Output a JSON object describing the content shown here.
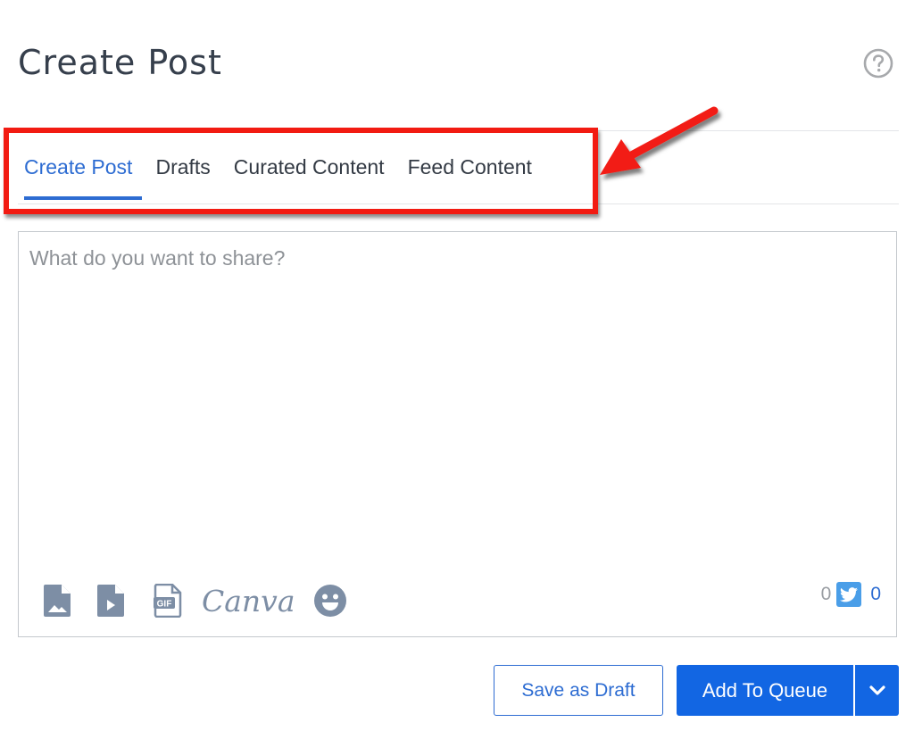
{
  "header": {
    "title": "Create Post",
    "help_icon": "question-circle-icon"
  },
  "tabs": [
    {
      "label": "Create Post",
      "active": true
    },
    {
      "label": "Drafts",
      "active": false
    },
    {
      "label": "Curated Content",
      "active": false
    },
    {
      "label": "Feed Content",
      "active": false
    }
  ],
  "annotation": {
    "highlight_color": "#f21b12",
    "type": "red box with arrow pointing at tabs"
  },
  "composer": {
    "value": "",
    "placeholder": "What do you want to share?",
    "attachments": [
      {
        "name": "image-file-icon"
      },
      {
        "name": "video-file-icon"
      },
      {
        "name": "gif-file-icon"
      },
      {
        "name": "canva-logo",
        "label": "Canva"
      },
      {
        "name": "emoji-icon"
      }
    ],
    "counter": {
      "total": "0",
      "network_icon": "twitter-icon",
      "twitter": "0"
    }
  },
  "actions": {
    "save_draft": "Save as Draft",
    "add_to_queue": "Add To Queue",
    "menu_icon": "chevron-down-icon"
  },
  "colors": {
    "accent": "#1266e3",
    "active_tab": "#2d6cd2",
    "icon_gray": "#7d8ea5",
    "twitter": "#4a9ee8"
  }
}
